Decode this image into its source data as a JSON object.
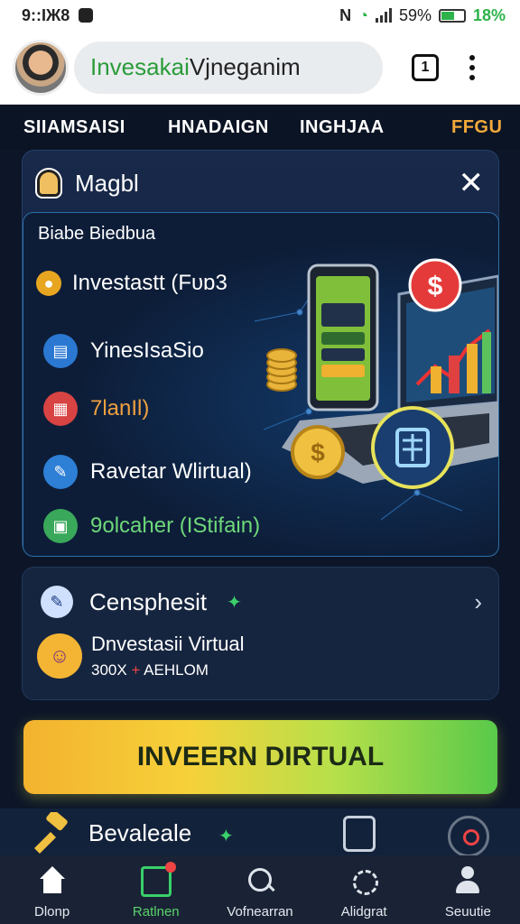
{
  "status_bar": {
    "time": "9::ꟷ",
    "time_display": "9::IЖ8",
    "battery_percent": "59%",
    "extra": "18%"
  },
  "header": {
    "search_text_green": "Invesakai",
    "search_text_rest": " Vjneganim"
  },
  "tabs": [
    "SIIAMSAISI",
    "HNADAIGN",
    "INGHJAA",
    "FFGU"
  ],
  "card": {
    "title": "Magbl",
    "inner_title": "Biabe Biedbua",
    "rows": [
      {
        "label": "Investastt (Fᴜɒ3",
        "icon": "coin-icon"
      },
      {
        "label": "YinesIsaSio",
        "icon": "document-icon"
      },
      {
        "label": "7lanIl)",
        "icon": "calculator-icon"
      },
      {
        "label": "Ravetar Wlirtual)",
        "icon": "pen-icon"
      },
      {
        "label": "9olcaher (IStifain)",
        "icon": "screen-icon"
      }
    ]
  },
  "card2": {
    "title": "Censphesit",
    "line1": "Dnvestasii Virtual",
    "line2_left": "300X",
    "line2_plus": "+",
    "line2_right": "AEHLOM"
  },
  "cta_label": "INVEERN DIRTUAL",
  "mini_row_label": "Bevaleale",
  "nav": [
    {
      "label": "Dlonp",
      "icon": "home-icon"
    },
    {
      "label": "Ratlnen",
      "icon": "chart-icon"
    },
    {
      "label": "Vofnearran",
      "icon": "search-icon"
    },
    {
      "label": "Alidgrat",
      "icon": "gear-icon"
    },
    {
      "label": "Seuutie",
      "icon": "user-icon"
    }
  ],
  "colors": {
    "accent_green": "#58d36a",
    "tab_highlight": "#f2a93b",
    "background": "#0c1628"
  }
}
